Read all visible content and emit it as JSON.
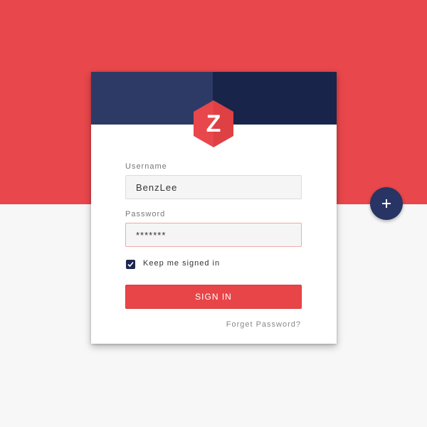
{
  "colors": {
    "background_top": "#e8474b",
    "background_bottom": "#f7f7f7",
    "header_left": "#2e3a66",
    "header_right": "#18244a",
    "accent": "#e84548",
    "navy": "#283463"
  },
  "logo": {
    "letter": "Z",
    "icon": "hexagon-logo"
  },
  "form": {
    "username_label": "Username",
    "username_value": "BenzLee",
    "password_label": "Password",
    "password_value": "*******",
    "remember_label": "Keep me signed in",
    "remember_checked": true,
    "signin_label": "SIGN IN",
    "forgot_label": "Forget Password?"
  },
  "fab": {
    "icon": "plus-icon"
  }
}
